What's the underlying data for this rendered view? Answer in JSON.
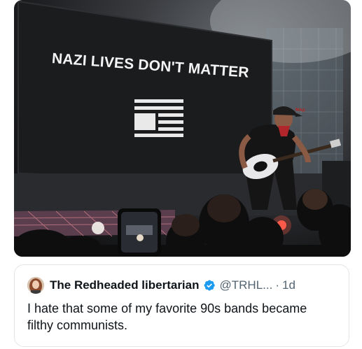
{
  "photo": {
    "screen_text": "NAZI LIVES DON'T MATTER",
    "cap_text": "MAD",
    "colors": {
      "screen": "#1b1c1e",
      "stage_red": "#c0392b",
      "wall_tile": "#8fa3b0"
    }
  },
  "tweet": {
    "display_name": "The Redheaded libertarian",
    "verified_icon": "verified-badge-icon",
    "handle": "@TRHL...",
    "separator": "·",
    "time": "1d",
    "text": "I hate that some of my favorite 90s bands became filthy communists.",
    "colors": {
      "verified": "#1d9bf0",
      "text": "#0f1419",
      "muted": "#536471"
    }
  }
}
